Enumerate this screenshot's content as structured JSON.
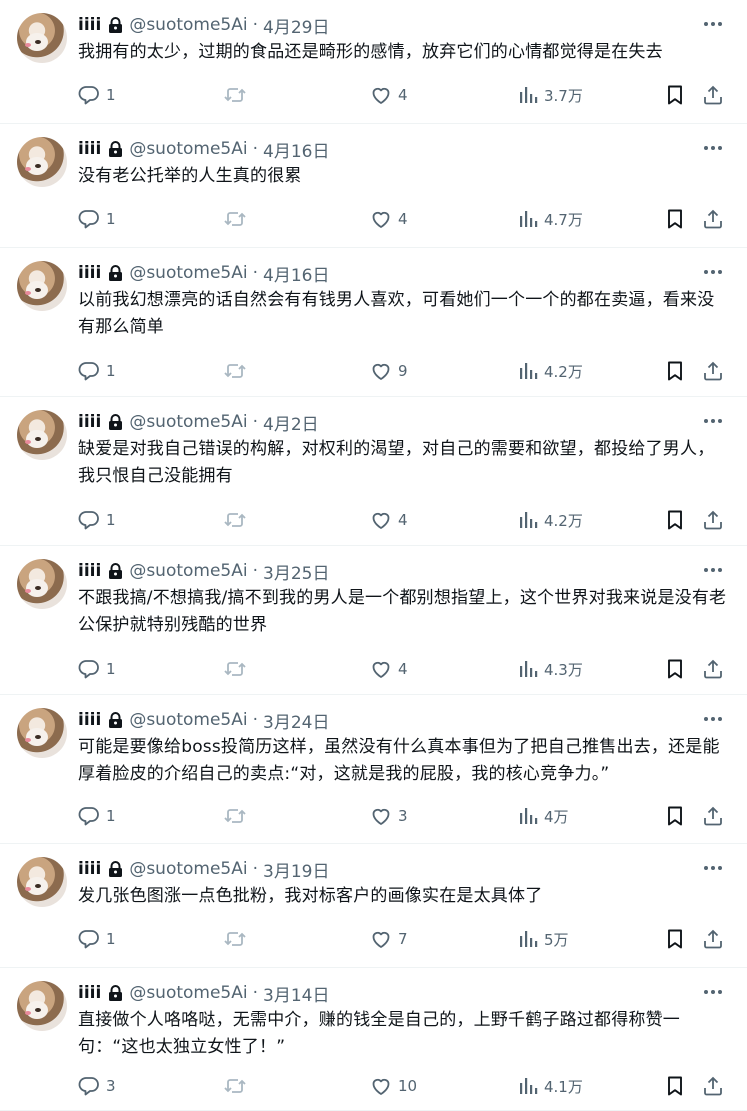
{
  "posts": [
    {
      "name": "iiii",
      "handle": "@suotome5Ai",
      "date": "4月29日",
      "text": "我拥有的太少，过期的食品还是畸形的感情，放弃它们的心情都觉得是在失去",
      "replies": "1",
      "retweets": "",
      "likes": "4",
      "views": "3.7万"
    },
    {
      "name": "iiii",
      "handle": "@suotome5Ai",
      "date": "4月16日",
      "text": "没有老公托举的人生真的很累",
      "replies": "1",
      "retweets": "",
      "likes": "4",
      "views": "4.7万"
    },
    {
      "name": "iiii",
      "handle": "@suotome5Ai",
      "date": "4月16日",
      "text": "以前我幻想漂亮的话自然会有有钱男人喜欢，可看她们一个一个的都在卖逼，看来没有那么简单",
      "replies": "1",
      "retweets": "",
      "likes": "9",
      "views": "4.2万"
    },
    {
      "name": "iiii",
      "handle": "@suotome5Ai",
      "date": "4月2日",
      "text": "缺爱是对我自己错误的构解，对权利的渴望，对自己的需要和欲望，都投给了男人，我只恨自己没能拥有",
      "replies": "1",
      "retweets": "",
      "likes": "4",
      "views": "4.2万"
    },
    {
      "name": "iiii",
      "handle": "@suotome5Ai",
      "date": "3月25日",
      "text": "不跟我搞/不想搞我/搞不到我的男人是一个都别想指望上，这个世界对我来说是没有老公保护就特别残酷的世界",
      "replies": "1",
      "retweets": "",
      "likes": "4",
      "views": "4.3万"
    },
    {
      "name": "iiii",
      "handle": "@suotome5Ai",
      "date": "3月24日",
      "text": "可能是要像给boss投简历这样，虽然没有什么真本事但为了把自己推售出去，还是能厚着脸皮的介绍自己的卖点:“对，这就是我的屁股，我的核心竞争力。”",
      "replies": "1",
      "retweets": "",
      "likes": "3",
      "views": "4万"
    },
    {
      "name": "iiii",
      "handle": "@suotome5Ai",
      "date": "3月19日",
      "text": "发几张色图涨一点色批粉，我对标客户的画像实在是太具体了",
      "replies": "1",
      "retweets": "",
      "likes": "7",
      "views": "5万"
    },
    {
      "name": "iiii",
      "handle": "@suotome5Ai",
      "date": "3月14日",
      "text": "直接做个人咯咯哒，无需中介，赚的钱全是自己的，上野千鹤子路过都得称赞一句：“这也太独立女性了！”",
      "replies": "3",
      "retweets": "",
      "likes": "10",
      "views": "4.1万"
    }
  ],
  "icons": {
    "lock": "lock-icon",
    "more": "more-icon",
    "reply": "reply-icon",
    "retweet": "retweet-icon",
    "like": "heart-icon",
    "views": "views-icon",
    "bookmark": "bookmark-icon",
    "share": "share-icon"
  },
  "colors": {
    "text": "#0f1419",
    "secondary": "#536471",
    "divider": "#eff3f4"
  }
}
